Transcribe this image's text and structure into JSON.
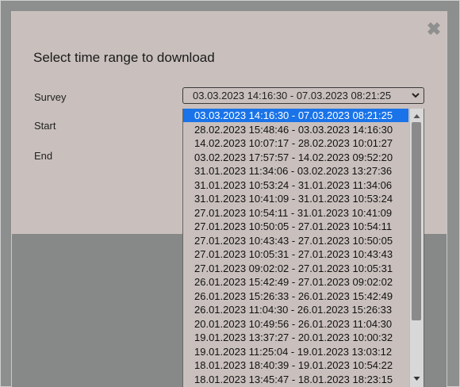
{
  "dialog": {
    "title": "Select time range to download",
    "close_icon": "close-icon"
  },
  "form": {
    "survey_label": "Survey",
    "start_label": "Start",
    "end_label": "End",
    "survey_selected": "03.03.2023 14:16:30 - 07.03.2023 08:21:25"
  },
  "options": [
    "03.03.2023 14:16:30 - 07.03.2023 08:21:25",
    "28.02.2023 15:48:46 - 03.03.2023 14:16:30",
    "14.02.2023 10:07:17 - 28.02.2023 10:01:27",
    "03.02.2023 17:57:57 - 14.02.2023 09:52:20",
    "31.01.2023 11:34:06 - 03.02.2023 13:27:36",
    "31.01.2023 10:53:24 - 31.01.2023 11:34:06",
    "31.01.2023 10:41:09 - 31.01.2023 10:53:24",
    "27.01.2023 10:54:11 - 31.01.2023 10:41:09",
    "27.01.2023 10:50:05 - 27.01.2023 10:54:11",
    "27.01.2023 10:43:43 - 27.01.2023 10:50:05",
    "27.01.2023 10:05:31 - 27.01.2023 10:43:43",
    "27.01.2023 09:02:02 - 27.01.2023 10:05:31",
    "26.01.2023 15:42:49 - 27.01.2023 09:02:02",
    "26.01.2023 15:26:33 - 26.01.2023 15:42:49",
    "26.01.2023 11:04:30 - 26.01.2023 15:26:33",
    "20.01.2023 10:49:56 - 26.01.2023 11:04:30",
    "19.01.2023 13:37:27 - 20.01.2023 10:00:32",
    "19.01.2023 11:25:04 - 19.01.2023 13:03:12",
    "18.01.2023 18:40:39 - 19.01.2023 10:54:22",
    "18.01.2023 13:45:47 - 18.01.2023 18:23:15"
  ],
  "selected_index": 0,
  "colors": {
    "highlight": "#1a73e8",
    "dialog_bg": "#c9c0bd",
    "overlay_bg": "#878888"
  }
}
